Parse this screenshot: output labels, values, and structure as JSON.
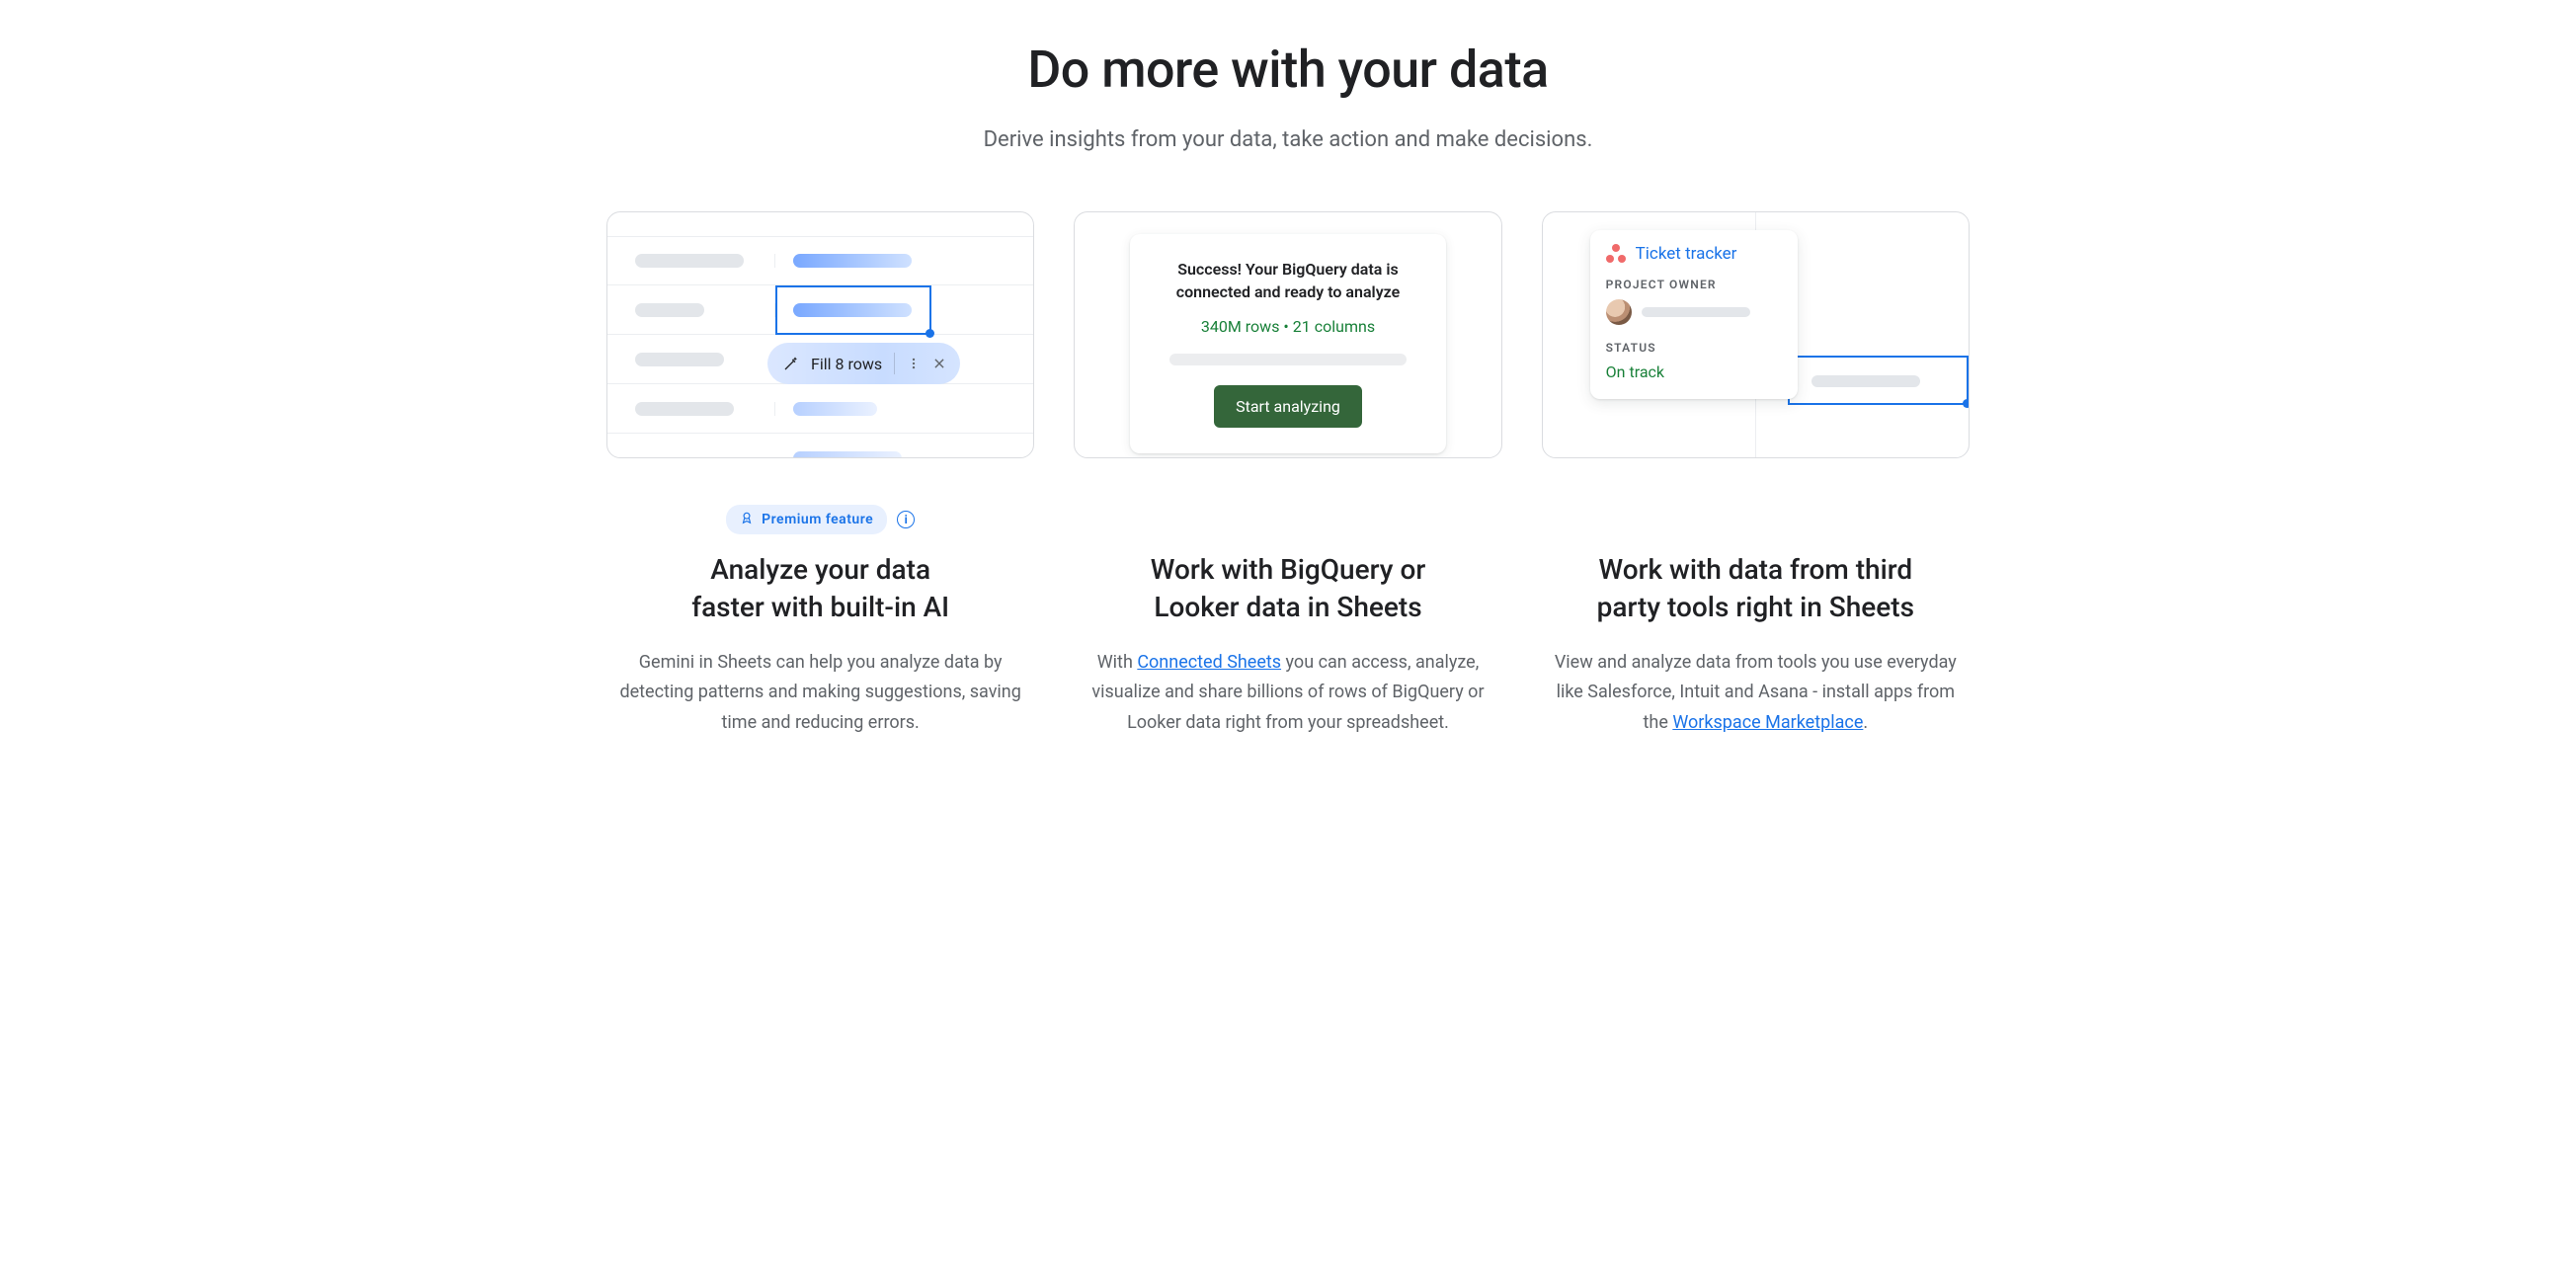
{
  "section": {
    "title": "Do more with your data",
    "subtitle": "Derive insights from your data, take action and make decisions."
  },
  "features": [
    {
      "premium_badge": "Premium feature",
      "title": "Analyze your data\nfaster with built-in AI",
      "body": "Gemini in Sheets can help you analyze data by detecting patterns and making suggestions, saving time and reducing errors.",
      "illus": {
        "pill_label": "Fill 8 rows"
      }
    },
    {
      "title": "Work with BigQuery or\nLooker data in Sheets",
      "body_pre": "With ",
      "link_text": "Connected Sheets",
      "body_post": " you can access, analyze, visualize and share billions of rows of BigQuery or Looker data right from your spreadsheet.",
      "illus": {
        "success_text": "Success! Your BigQuery data is connected and ready to analyze",
        "meta_text": "340M rows • 21 columns",
        "button_label": "Start analyzing"
      }
    },
    {
      "title": "Work with data from third\nparty tools right in Sheets",
      "body_pre": "View and analyze data from tools you use everyday like Salesforce, Intuit and Asana - install apps from the ",
      "link_text": "Workspace Marketplace",
      "body_post": ".",
      "illus": {
        "card_title": "Ticket tracker",
        "owner_label": "PROJECT OWNER",
        "status_label": "STATUS",
        "status_value": "On track"
      }
    }
  ]
}
